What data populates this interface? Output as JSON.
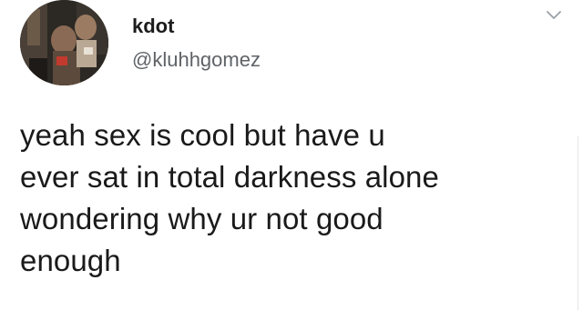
{
  "tweet": {
    "author": {
      "display_name": "kdot",
      "handle": "@kluhhgomez",
      "avatar_icon": "profile-photo"
    },
    "menu_icon": "chevron-down-icon",
    "text_lines": [
      "yeah sex is cool but have u",
      "ever sat in total darkness alone",
      "wondering why ur not good",
      "enough"
    ]
  },
  "colors": {
    "background": "#ffffff",
    "text": "#1a1a1a",
    "handle": "#5f6368",
    "chevron": "#9aa0a6"
  }
}
